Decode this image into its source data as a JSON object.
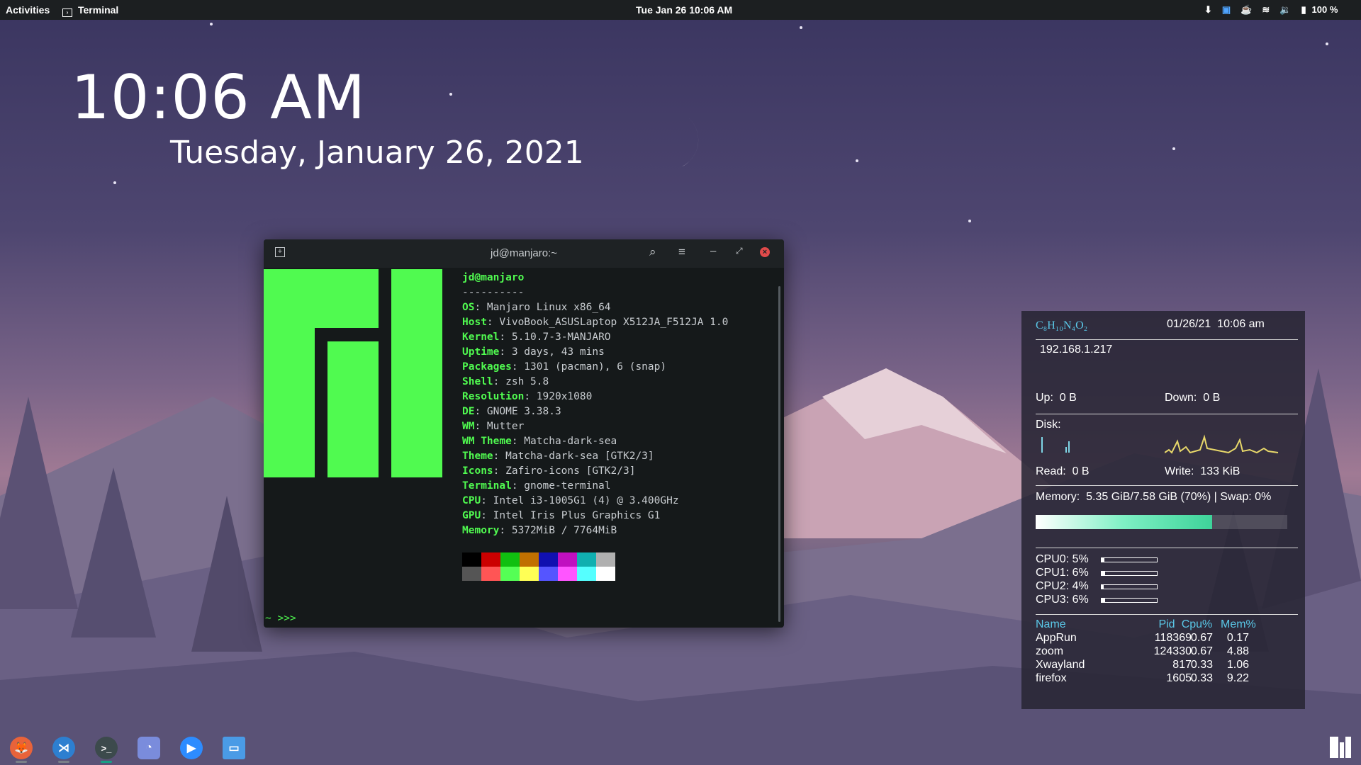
{
  "topbar": {
    "activities": "Activities",
    "app_name": "Terminal",
    "clock": "Tue Jan 26  10:06 AM",
    "battery": "100 %"
  },
  "desktop": {
    "time": "10:06 AM",
    "date": "Tuesday, January 26, 2021"
  },
  "terminal": {
    "title": "jd@manjaro:~",
    "user": "jd@manjaro",
    "separator": "----------",
    "info": [
      {
        "k": "OS",
        "v": "Manjaro Linux x86_64"
      },
      {
        "k": "Host",
        "v": "VivoBook_ASUSLaptop X512JA_F512JA 1.0"
      },
      {
        "k": "Kernel",
        "v": "5.10.7-3-MANJARO"
      },
      {
        "k": "Uptime",
        "v": "3 days, 43 mins"
      },
      {
        "k": "Packages",
        "v": "1301 (pacman), 6 (snap)"
      },
      {
        "k": "Shell",
        "v": "zsh 5.8"
      },
      {
        "k": "Resolution",
        "v": "1920x1080"
      },
      {
        "k": "DE",
        "v": "GNOME 3.38.3"
      },
      {
        "k": "WM",
        "v": "Mutter"
      },
      {
        "k": "WM Theme",
        "v": "Matcha-dark-sea"
      },
      {
        "k": "Theme",
        "v": "Matcha-dark-sea [GTK2/3]"
      },
      {
        "k": "Icons",
        "v": "Zafiro-icons [GTK2/3]"
      },
      {
        "k": "Terminal",
        "v": "gnome-terminal"
      },
      {
        "k": "CPU",
        "v": "Intel i3-1005G1 (4) @ 3.400GHz"
      },
      {
        "k": "GPU",
        "v": "Intel Iris Plus Graphics G1"
      },
      {
        "k": "Memory",
        "v": "5372MiB / 7764MiB"
      }
    ],
    "palette_top": [
      "#000000",
      "#cc0000",
      "#10c010",
      "#c07000",
      "#1010b0",
      "#c010c0",
      "#10b0b0",
      "#b0b0b0"
    ],
    "palette_bottom": [
      "#555555",
      "#ff5555",
      "#55ff55",
      "#ffff55",
      "#5555ff",
      "#ff55ff",
      "#55ffff",
      "#ffffff"
    ],
    "prompt": "~ >>>",
    "logo_color": "#50fa50"
  },
  "conky": {
    "title": "C₈H₁₀N₄O₂",
    "datetime": "01/26/21  10:06 am",
    "ip": "192.168.1.217",
    "up": "Up:  0 B",
    "down": "Down:  0 B",
    "disk_label": "Disk:",
    "read": "Read:  0 B",
    "write": "Write:  133 KiB",
    "memory": "Memory:  5.35 GiB/7.58 GiB (70%) | Swap: 0%",
    "memory_fraction": 0.7,
    "cpus": [
      {
        "label": "CPU0: 5%",
        "fraction": 0.05
      },
      {
        "label": "CPU1: 6%",
        "fraction": 0.06
      },
      {
        "label": "CPU2: 4%",
        "fraction": 0.04
      },
      {
        "label": "CPU3: 6%",
        "fraction": 0.06
      }
    ],
    "proc_headers": [
      "Name",
      "Pid",
      "Cpu%",
      "Mem%"
    ],
    "procs": [
      [
        "AppRun",
        "118369",
        "0.67",
        "0.17"
      ],
      [
        "zoom",
        "124330",
        "0.67",
        "4.88"
      ],
      [
        "Xwayland",
        "817",
        "0.33",
        "1.06"
      ],
      [
        "firefox",
        "1605",
        "0.33",
        "9.22"
      ]
    ]
  },
  "dock": {
    "apps": [
      "firefox-icon",
      "vscode-icon",
      "terminal-icon",
      "discord-icon",
      "zoom-icon",
      "files-icon"
    ],
    "accent": "#16a085"
  }
}
